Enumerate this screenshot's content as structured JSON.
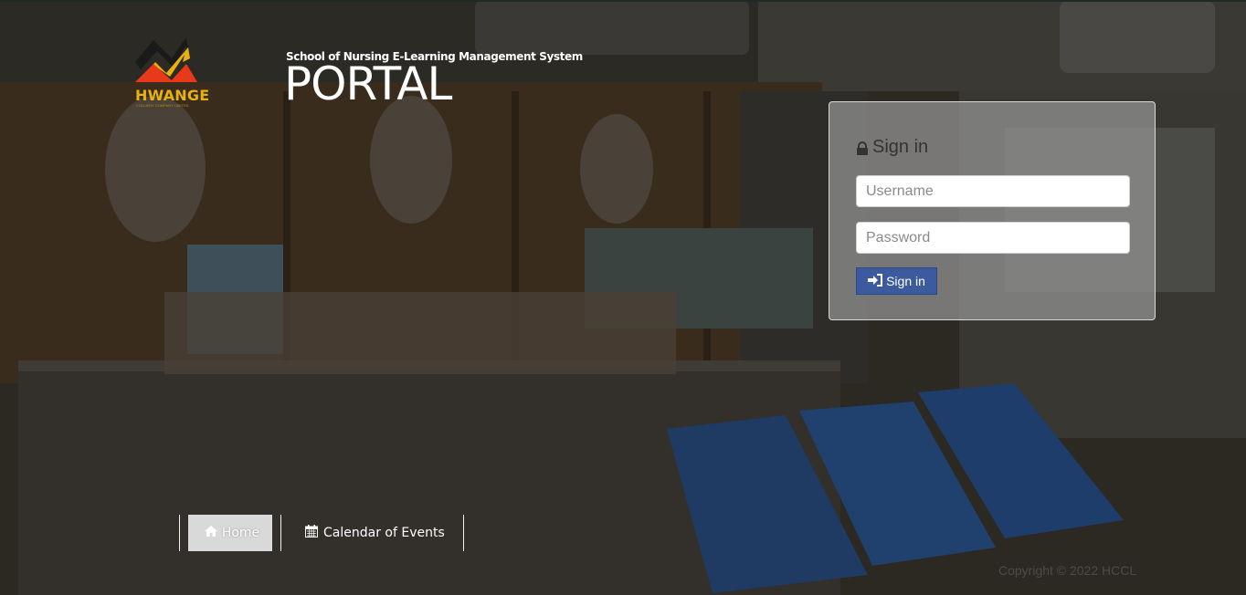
{
  "brand": {
    "logo_name": "HWANGE",
    "logo_tagline": "COLLIERY COMPANY LIMITED",
    "subtitle": "School of Nursing E-Learning Management System",
    "title": "PORTAL"
  },
  "login": {
    "heading": "Sign in",
    "username_placeholder": "Username",
    "password_placeholder": "Password",
    "submit_label": "Sign in"
  },
  "nav": {
    "items": [
      {
        "label": "Home",
        "icon": "home-icon",
        "active": true
      },
      {
        "label": "Calendar of Events",
        "icon": "calendar-icon",
        "active": false
      }
    ]
  },
  "footer": {
    "copyright": "Copyright © 2022 HCCL"
  },
  "colors": {
    "accent_button": "#3c5a9e",
    "logo_yellow": "#e8b010",
    "logo_red": "#e83a1a"
  }
}
